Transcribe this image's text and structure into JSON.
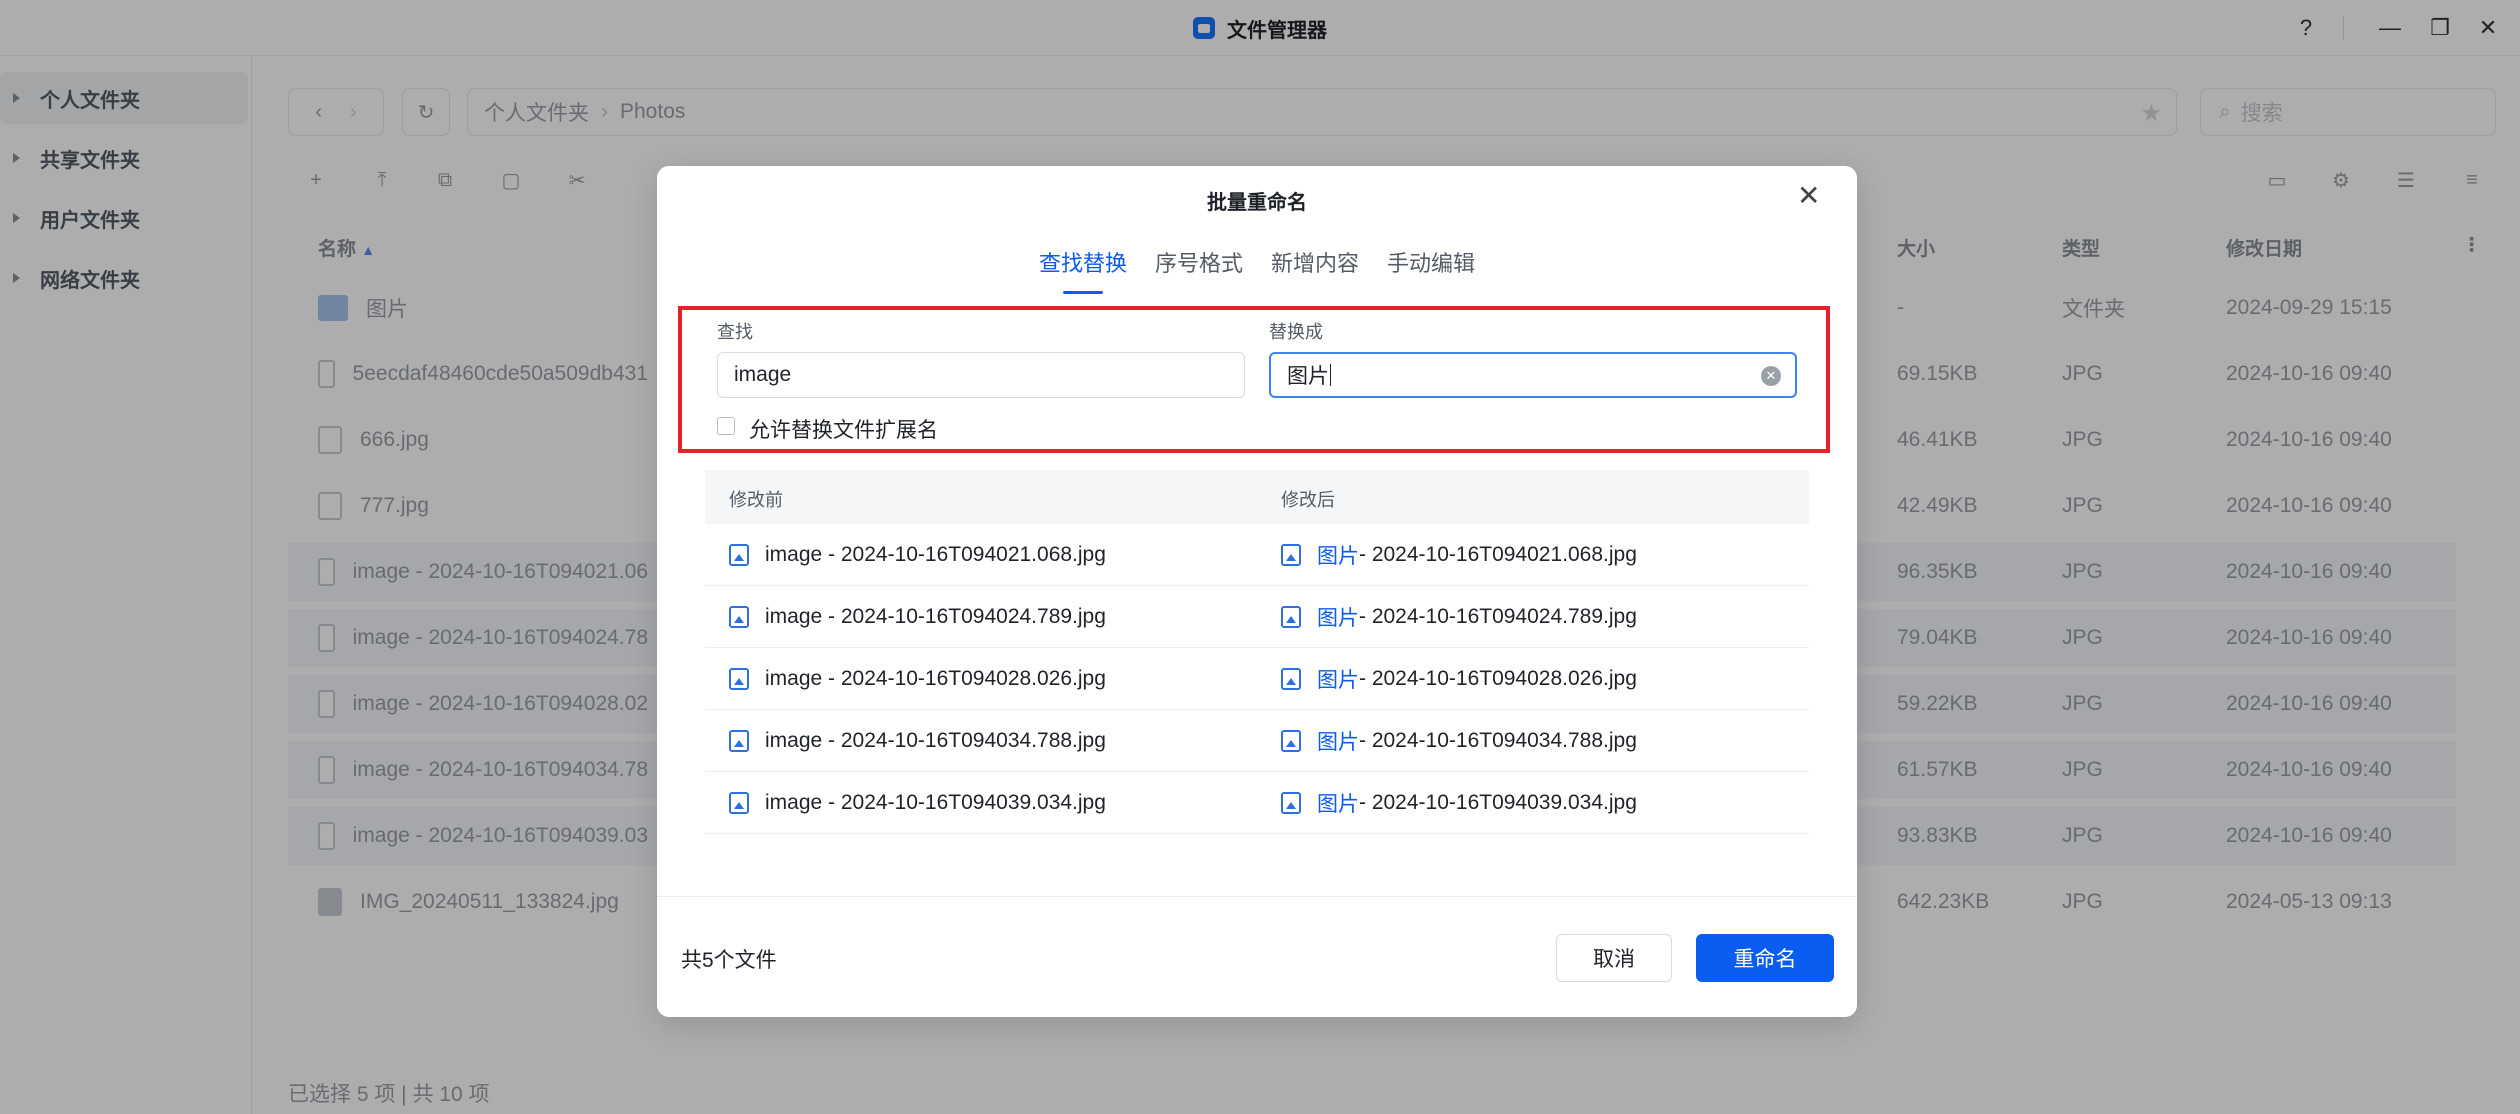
{
  "window": {
    "title": "文件管理器",
    "help": "?",
    "minimize": "—",
    "maximize": "❐",
    "close": "✕"
  },
  "sidebar": {
    "items": [
      {
        "label": "个人文件夹"
      },
      {
        "label": "共享文件夹"
      },
      {
        "label": "用户文件夹"
      },
      {
        "label": "网络文件夹"
      }
    ]
  },
  "toolbar": {
    "path_root": "个人文件夹",
    "path_current": "Photos",
    "search_placeholder": "搜索"
  },
  "file_table": {
    "columns": {
      "name": "名称",
      "size": "大小",
      "type": "类型",
      "date": "修改日期"
    },
    "rows": [
      {
        "name": "图片",
        "size": "-",
        "type": "文件夹",
        "date": "2024-09-29 15:15"
      },
      {
        "name": "5eecdaf48460cde50a509db431",
        "size": "69.15KB",
        "type": "JPG",
        "date": "2024-10-16 09:40"
      },
      {
        "name": "666.jpg",
        "size": "46.41KB",
        "type": "JPG",
        "date": "2024-10-16 09:40"
      },
      {
        "name": "777.jpg",
        "size": "42.49KB",
        "type": "JPG",
        "date": "2024-10-16 09:40"
      },
      {
        "name": "image - 2024-10-16T094021.06",
        "size": "96.35KB",
        "type": "JPG",
        "date": "2024-10-16 09:40"
      },
      {
        "name": "image - 2024-10-16T094024.78",
        "size": "79.04KB",
        "type": "JPG",
        "date": "2024-10-16 09:40"
      },
      {
        "name": "image - 2024-10-16T094028.02",
        "size": "59.22KB",
        "type": "JPG",
        "date": "2024-10-16 09:40"
      },
      {
        "name": "image - 2024-10-16T094034.78",
        "size": "61.57KB",
        "type": "JPG",
        "date": "2024-10-16 09:40"
      },
      {
        "name": "image - 2024-10-16T094039.03",
        "size": "93.83KB",
        "type": "JPG",
        "date": "2024-10-16 09:40"
      },
      {
        "name": "IMG_20240511_133824.jpg",
        "size": "642.23KB",
        "type": "JPG",
        "date": "2024-05-13 09:13"
      }
    ],
    "status": "已选择 5 项 | 共 10 项"
  },
  "dialog": {
    "title": "批量重命名",
    "tabs": [
      "查找替换",
      "序号格式",
      "新增内容",
      "手动编辑"
    ],
    "find_label": "查找",
    "find_value": "image",
    "replace_label": "替换成",
    "replace_value": "图片",
    "allow_ext_label": "允许替换文件扩展名",
    "allow_ext_checked": false,
    "table_head_before": "修改前",
    "table_head_after": "修改后",
    "renames": [
      {
        "before": "image - 2024-10-16T094021.068.jpg",
        "after_prefix": "图片",
        "after_rest": " - 2024-10-16T094021.068.jpg"
      },
      {
        "before": "image - 2024-10-16T094024.789.jpg",
        "after_prefix": "图片",
        "after_rest": " - 2024-10-16T094024.789.jpg"
      },
      {
        "before": "image - 2024-10-16T094028.026.jpg",
        "after_prefix": "图片",
        "after_rest": " - 2024-10-16T094028.026.jpg"
      },
      {
        "before": "image - 2024-10-16T094034.788.jpg",
        "after_prefix": "图片",
        "after_rest": " - 2024-10-16T094034.788.jpg"
      },
      {
        "before": "image - 2024-10-16T094039.034.jpg",
        "after_prefix": "图片",
        "after_rest": " - 2024-10-16T094039.034.jpg"
      }
    ],
    "file_count": "共5个文件",
    "cancel_label": "取消",
    "confirm_label": "重命名",
    "accent_color": "#0b5cf0",
    "highlight_color": "#e8202a"
  }
}
